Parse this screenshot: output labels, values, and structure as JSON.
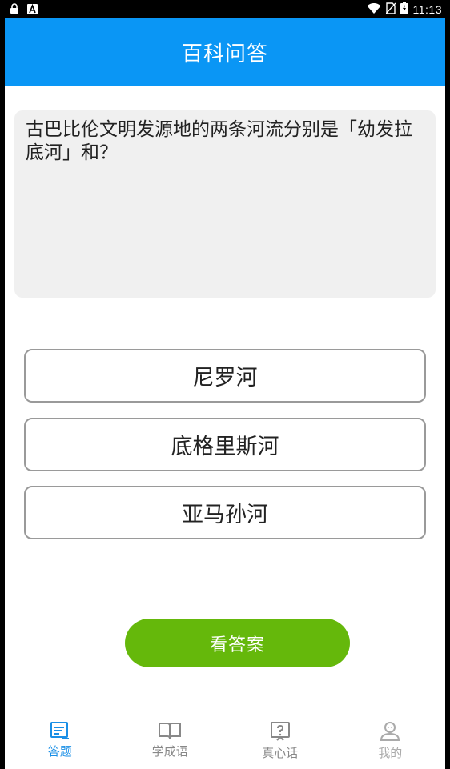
{
  "status_bar": {
    "time": "11:13",
    "icons": [
      "lock-icon",
      "a-icon",
      "wifi-icon",
      "no-sim-icon",
      "battery-charging-icon"
    ]
  },
  "header": {
    "title": "百科问答"
  },
  "question": {
    "text": "古巴比伦文明发源地的两条河流分别是「幼发拉底河」和？"
  },
  "options": [
    {
      "label": "尼罗河"
    },
    {
      "label": "底格里斯河"
    },
    {
      "label": "亚马孙河"
    }
  ],
  "answer_button": {
    "label": "看答案"
  },
  "tabs": [
    {
      "label": "答题",
      "icon": "quiz-icon",
      "active": true
    },
    {
      "label": "学成语",
      "icon": "book-icon",
      "active": false
    },
    {
      "label": "真心话",
      "icon": "question-card-icon",
      "active": false
    },
    {
      "label": "我的",
      "icon": "user-icon",
      "active": false
    }
  ],
  "colors": {
    "primary": "#0a96f5",
    "answer_button": "#65b80b",
    "tab_active": "#1a8fe6",
    "tab_inactive": "#888888",
    "tab_disabled": "#aaaaaa"
  }
}
